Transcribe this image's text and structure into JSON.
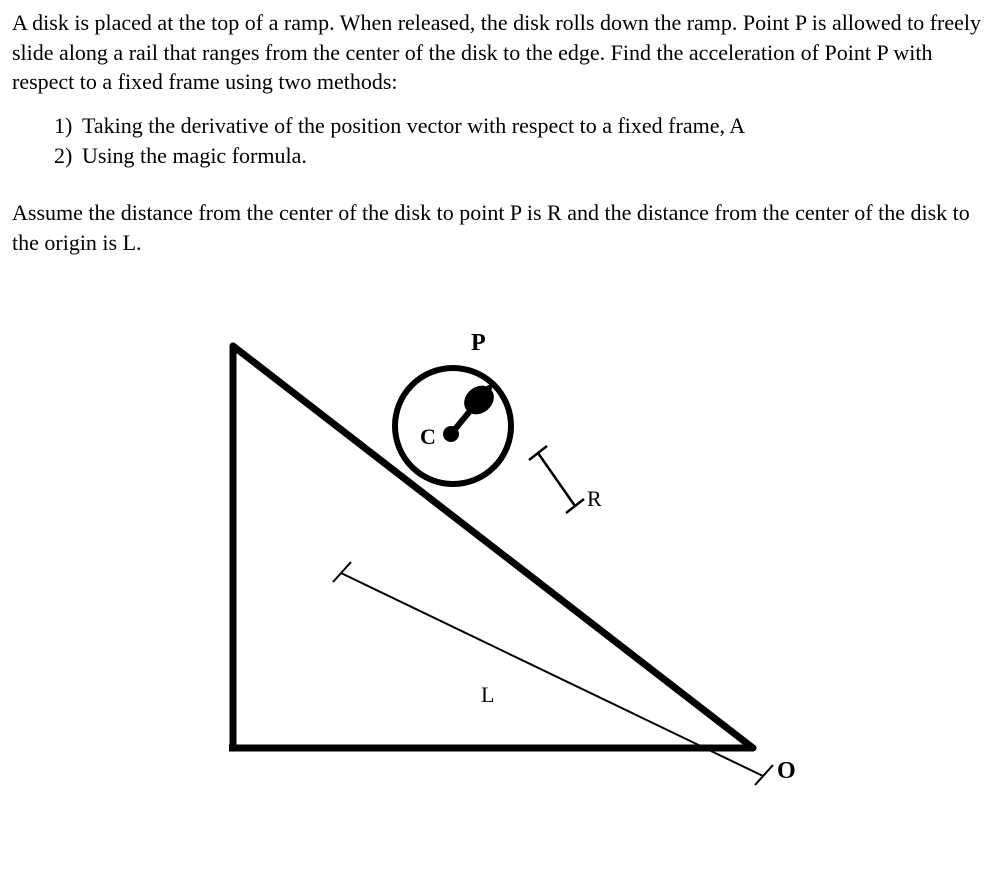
{
  "intro": "A disk is placed at the top of a ramp. When released, the disk rolls down the ramp. Point P is allowed to freely slide along a rail that ranges from the center of the disk to the edge. Find the acceleration of Point P with respect to a fixed frame using two methods:",
  "methods": [
    {
      "num": "1)",
      "text": "Taking the derivative of the position vector with respect to a fixed frame, A"
    },
    {
      "num": "2)",
      "text": "Using the magic formula."
    }
  ],
  "assume": "Assume the distance from the center of the disk to point P is R and the distance from the center of the disk to the origin is L.",
  "figure": {
    "labels": {
      "P": "P",
      "C": "C",
      "R": "R",
      "L": "L",
      "O": "O"
    }
  }
}
